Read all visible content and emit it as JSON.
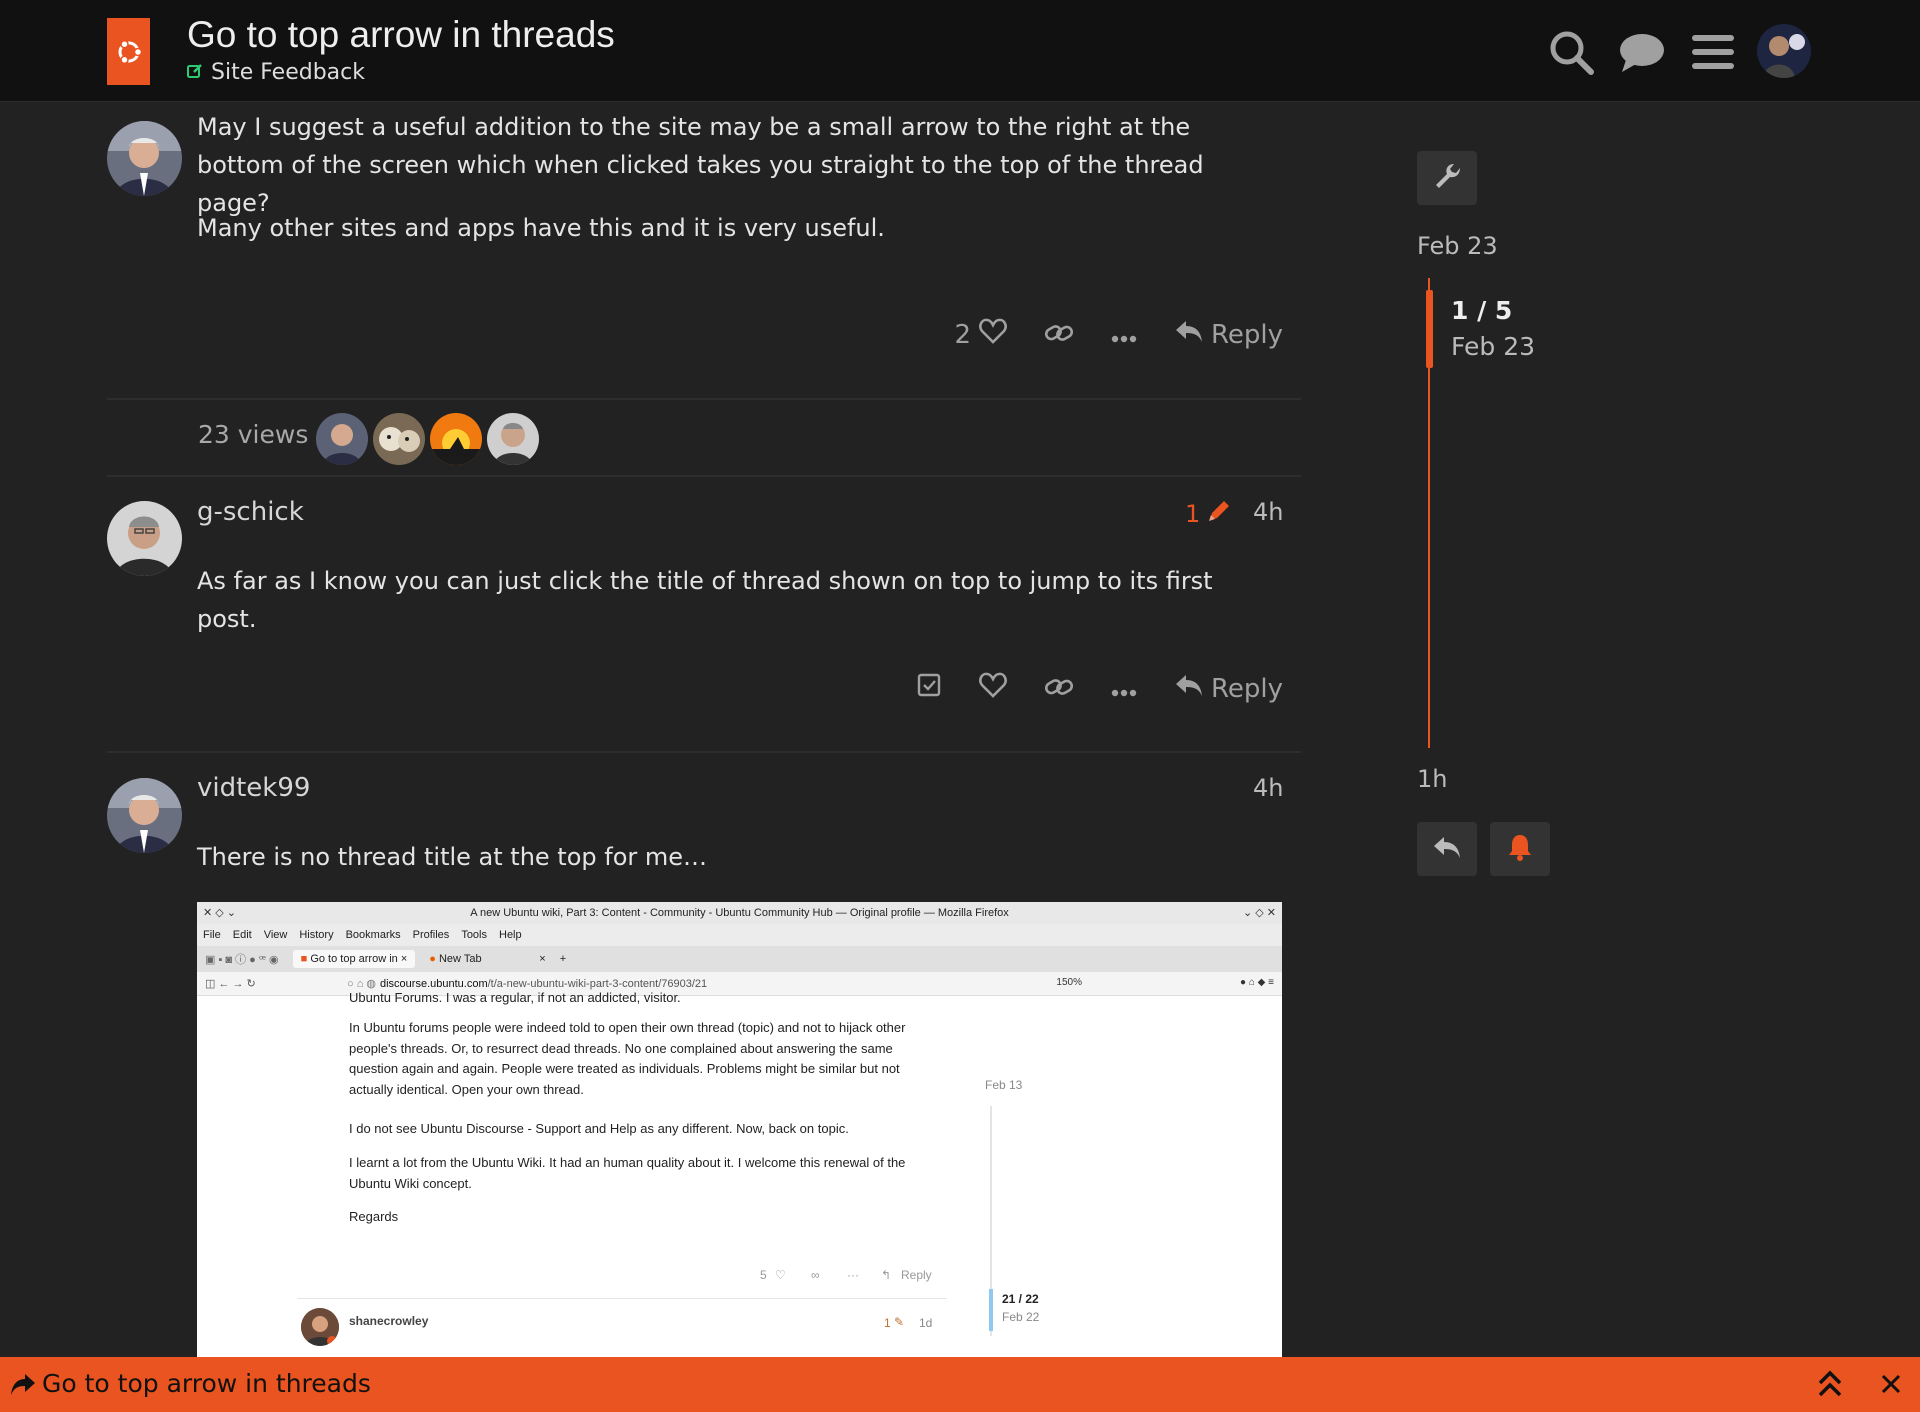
{
  "header": {
    "topic_title": "Go to top arrow in threads",
    "category": "Site Feedback"
  },
  "colors": {
    "accent": "#E95420",
    "background": "#222222",
    "header": "#111111"
  },
  "icons": [
    "ubuntu-logo-icon",
    "search-icon",
    "chat-icon",
    "hamburger-menu-icon",
    "user-avatar",
    "wrench-icon",
    "heart-icon",
    "link-icon",
    "ellipsis-icon",
    "reply-icon",
    "pencil-icon",
    "checkbox-icon",
    "bell-icon",
    "double-chevron-up-icon",
    "close-icon",
    "share-icon"
  ],
  "post1": {
    "paragraph1": "May I suggest a useful addition to the site may be a small arrow to the right at the bottom of the screen which when clicked takes you straight to the top of the thread page?",
    "paragraph2": "Many other sites and apps have this and it is very useful.",
    "like_count": "2",
    "reply_label": "Reply"
  },
  "topic_map": {
    "views": "23 views"
  },
  "post2": {
    "username": "g-schick",
    "edit_count": "1",
    "age": "4h",
    "text": "As far as I know you can just click the title of thread shown on top to jump to its first post.",
    "reply_label": "Reply"
  },
  "post3": {
    "username": "vidtek99",
    "age": "4h",
    "text": "There is no thread title at the top for me…"
  },
  "screenshot": {
    "window_title": "A new Ubuntu wiki, Part 3: Content - Community - Ubuntu Community Hub — Original profile — Mozilla Firefox",
    "menu": [
      "File",
      "Edit",
      "View",
      "History",
      "Bookmarks",
      "Profiles",
      "Tools",
      "Help"
    ],
    "tab1": "Go to top arrow in",
    "tab2": "New Tab",
    "tab_close": "×",
    "tab_new": "+",
    "url_domain": "discourse.ubuntu.com",
    "url_path": "/t/a-new-ubuntu-wiki-part-3-content/76903/21",
    "zoom": "150%",
    "partial_line": "Ubuntu Forums. I was a regular, if not an addicted, visitor.",
    "para1": "In Ubuntu forums people were indeed told to open their own thread (topic) and not to hijack other people's threads. Or, to resurrect dead threads. No one complained about answering the same question again and again. People were treated as individuals. Problems might be similar but not actually identical. Open your own thread.",
    "para2": "I do not see Ubuntu Discourse - Support and Help as any different. Now, back on topic.",
    "para3": "I learnt a lot from the Ubuntu Wiki. It had an human quality about it. I welcome this renewal of the Ubuntu Wiki concept.",
    "para4": "Regards",
    "timeline_date": "Feb 13",
    "like_count": "5",
    "reply_label": "Reply",
    "tl_count": "21 / 22",
    "tl_date": "Feb 22",
    "next_user": "shanecrowley",
    "next_edit": "1",
    "next_age": "1d"
  },
  "timeline": {
    "start_date": "Feb 23",
    "position": "1 / 5",
    "position_date": "Feb 23",
    "end_label": "1h"
  },
  "bottom_bar": {
    "title": "Go to top arrow in threads"
  }
}
